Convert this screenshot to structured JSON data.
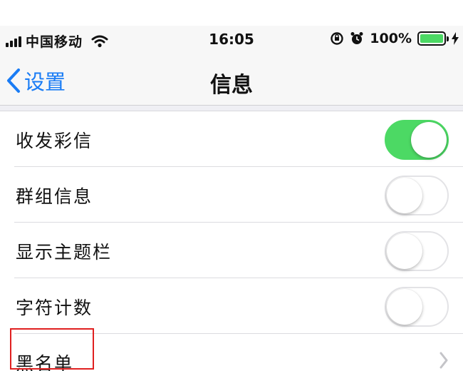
{
  "status_bar": {
    "carrier": "中国移动",
    "time": "16:05",
    "battery_percent": "100%",
    "battery_level": 1.0,
    "icons": [
      "signal-icon",
      "wifi-icon",
      "lock-rotation-icon",
      "alarm-icon",
      "battery-icon",
      "charging-icon"
    ]
  },
  "nav": {
    "back_label": "设置",
    "title": "信息"
  },
  "settings": [
    {
      "label": "收发彩信",
      "control": "toggle",
      "on": true
    },
    {
      "label": "群组信息",
      "control": "toggle",
      "on": false
    },
    {
      "label": "显示主题栏",
      "control": "toggle",
      "on": false
    },
    {
      "label": "字符计数",
      "control": "toggle",
      "on": false
    },
    {
      "label": "黑名单",
      "control": "disclosure"
    }
  ],
  "colors": {
    "accent": "#1a7cf5",
    "toggle_on": "#4cd964",
    "highlight_box": "#e02020"
  }
}
